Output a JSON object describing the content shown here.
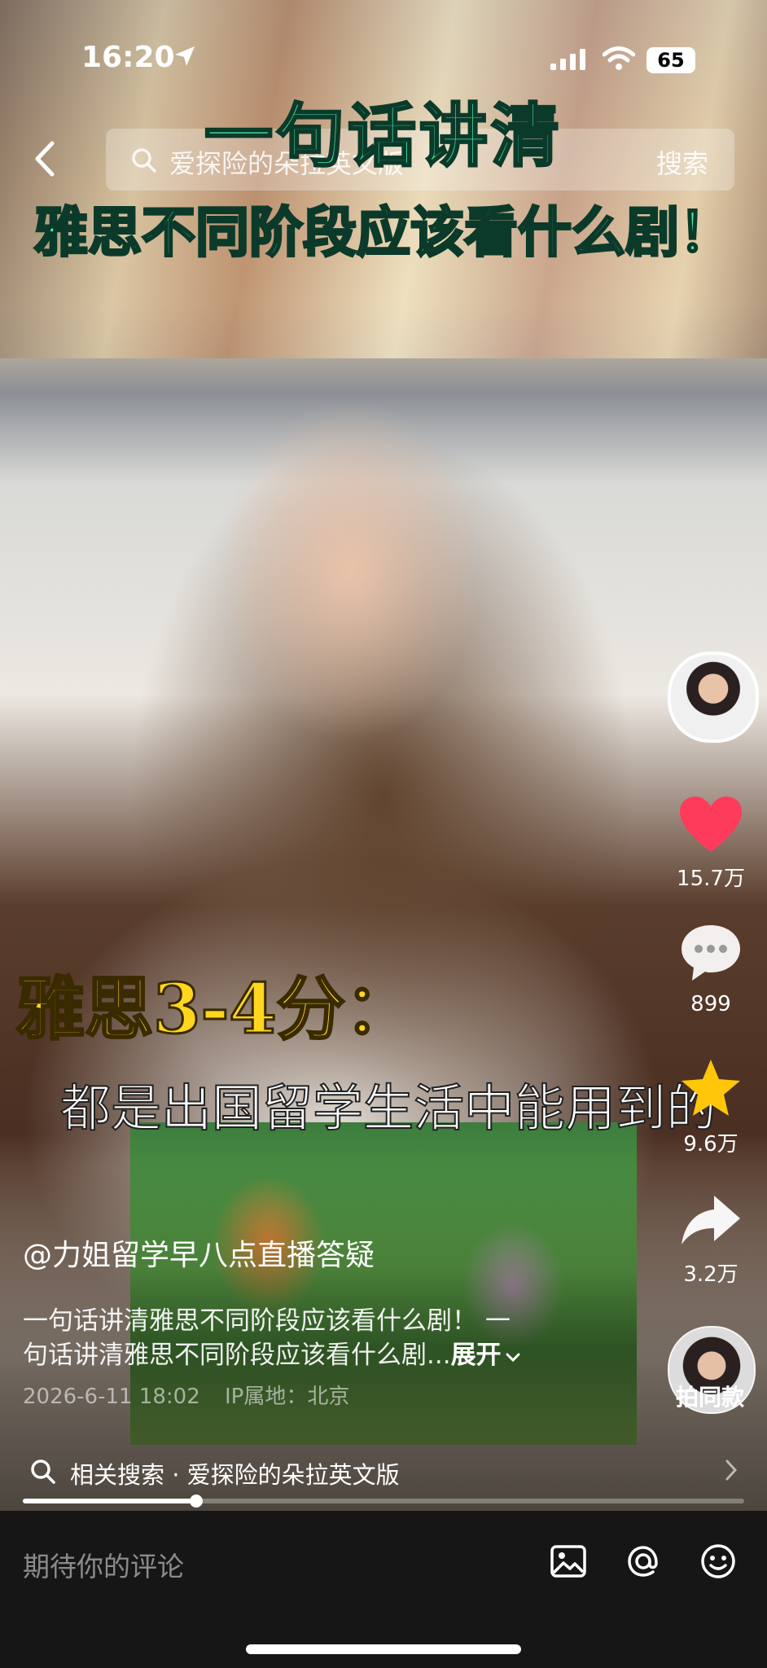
{
  "status_bar": {
    "time": "16:20",
    "battery": "65"
  },
  "search": {
    "query": "爱探险的朵拉英文版",
    "button_label": "搜索"
  },
  "video": {
    "title_line1": "一句话讲清",
    "title_line2": "雅思不同阶段应该看什么剧！",
    "caption_score": "雅思3-4分：",
    "caption_line": "都是出国留学生活中能用到的"
  },
  "rail": {
    "likes": "15.7万",
    "comments": "899",
    "favorites": "9.6万",
    "shares": "3.2万",
    "same_style_label": "拍同款"
  },
  "post": {
    "author": "@力姐留学早八点直播答疑",
    "desc_line1": "一句话讲清雅思不同阶段应该看什么剧！ 一",
    "desc_line2": "句话讲清雅思不同阶段应该看什么剧...",
    "expand_label": "展开",
    "date": "2026-6-11 18:02",
    "ip_location": "IP属地：北京"
  },
  "related_search": {
    "label": "相关搜索",
    "separator": "·",
    "term": "爱探险的朵拉英文版"
  },
  "playback": {
    "progress": 0.24
  },
  "comment_bar": {
    "placeholder": "期待你的评论"
  },
  "colors": {
    "like": "#ff3b5c",
    "favorite": "#ffc60a",
    "title_green": "#4fe0a1",
    "caption_yellow": "#ffd61f"
  }
}
